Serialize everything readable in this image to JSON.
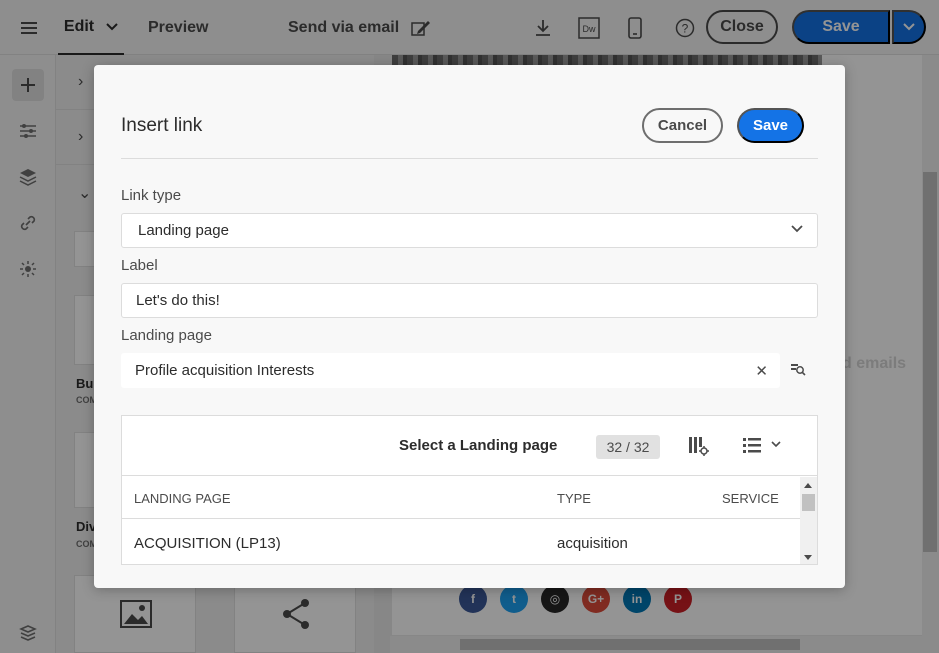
{
  "topbar": {
    "edit_label": "Edit",
    "preview_label": "Preview",
    "send_email_label": "Send via email",
    "dw_label": "Dw",
    "help_label": "?",
    "close_label": "Close",
    "save_label": "Save"
  },
  "leftpanel": {
    "components": [
      {
        "label": "Bu",
        "sub": "COM"
      },
      {
        "label": "Div",
        "sub": "COM"
      }
    ]
  },
  "canvas": {
    "ghost_text": "d emails",
    "social": [
      {
        "icon": "facebook-icon",
        "glyph": "f",
        "color": "#3b5998"
      },
      {
        "icon": "twitter-icon",
        "glyph": "t",
        "color": "#1da1f2"
      },
      {
        "icon": "instagram-icon",
        "glyph": "◎",
        "color": "#262626"
      },
      {
        "icon": "google-plus-icon",
        "glyph": "G+",
        "color": "#dd4b39"
      },
      {
        "icon": "linkedin-icon",
        "glyph": "in",
        "color": "#0077b5"
      },
      {
        "icon": "pinterest-icon",
        "glyph": "P",
        "color": "#cb2027"
      }
    ]
  },
  "dialog": {
    "title": "Insert link",
    "cancel_label": "Cancel",
    "save_label": "Save",
    "link_type": {
      "label": "Link type",
      "value": "Landing page"
    },
    "label_field": {
      "label": "Label",
      "value": "Let's do this!"
    },
    "landing_page": {
      "label": "Landing page",
      "value": "Profile acquisition Interests",
      "clear": "✕"
    },
    "table": {
      "title": "Select a Landing page",
      "count": "32 / 32",
      "columns": [
        "LANDING PAGE",
        "TYPE",
        "SERVICE"
      ],
      "rows": [
        {
          "landing_page": "ACQUISITION (LP13)",
          "type": "acquisition",
          "service": ""
        }
      ]
    }
  },
  "colors": {
    "accent": "#1473e6"
  }
}
